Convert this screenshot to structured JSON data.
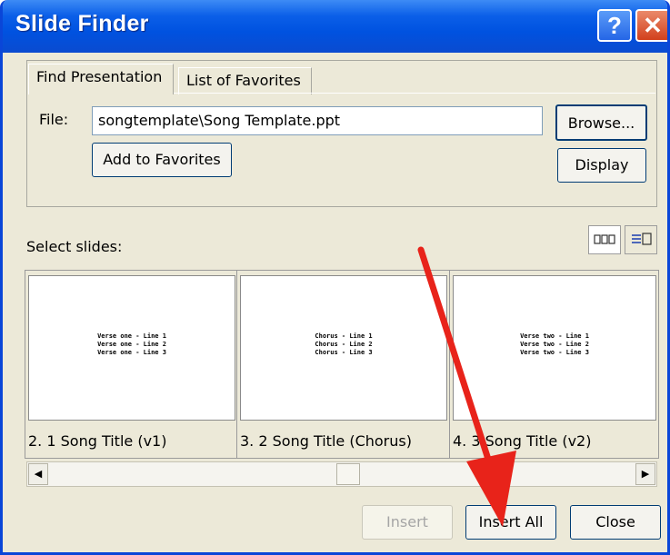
{
  "window": {
    "title": "Slide Finder"
  },
  "titlebar": {
    "help_glyph": "?",
    "close_glyph": "✕"
  },
  "tabs": {
    "find": "Find Presentation",
    "favorites": "List of Favorites"
  },
  "file": {
    "label": "File:",
    "value": "songtemplate\\Song Template.ppt",
    "browse": "Browse...",
    "add_favorites": "Add to Favorites",
    "display": "Display"
  },
  "select_label": "Select slides:",
  "slides": [
    {
      "caption": "2.  1 Song Title  (v1)",
      "lines": "Verse one - Line 1\nVerse one - Line 2\nVerse one - Line 3"
    },
    {
      "caption": "3.  2 Song Title  (Chorus)",
      "lines": "Chorus - Line 1\nChorus - Line 2\nChorus - Line 3"
    },
    {
      "caption": "4.  3 Song Title  (v2)",
      "lines": "Verse two - Line 1\nVerse two - Line 2\nVerse two - Line 3"
    }
  ],
  "scrollbar": {
    "left": "◀",
    "right": "▶"
  },
  "buttons": {
    "insert": "Insert",
    "insert_all": "Insert All",
    "close": "Close"
  },
  "colors": {
    "titlebar": "#0052e0",
    "dialog_bg": "#ece9d8",
    "annotation_arrow": "#e8231a"
  },
  "icons": {
    "view_thumbnails": "slide-thumbnail-view-icon",
    "view_list": "slide-list-view-icon"
  }
}
